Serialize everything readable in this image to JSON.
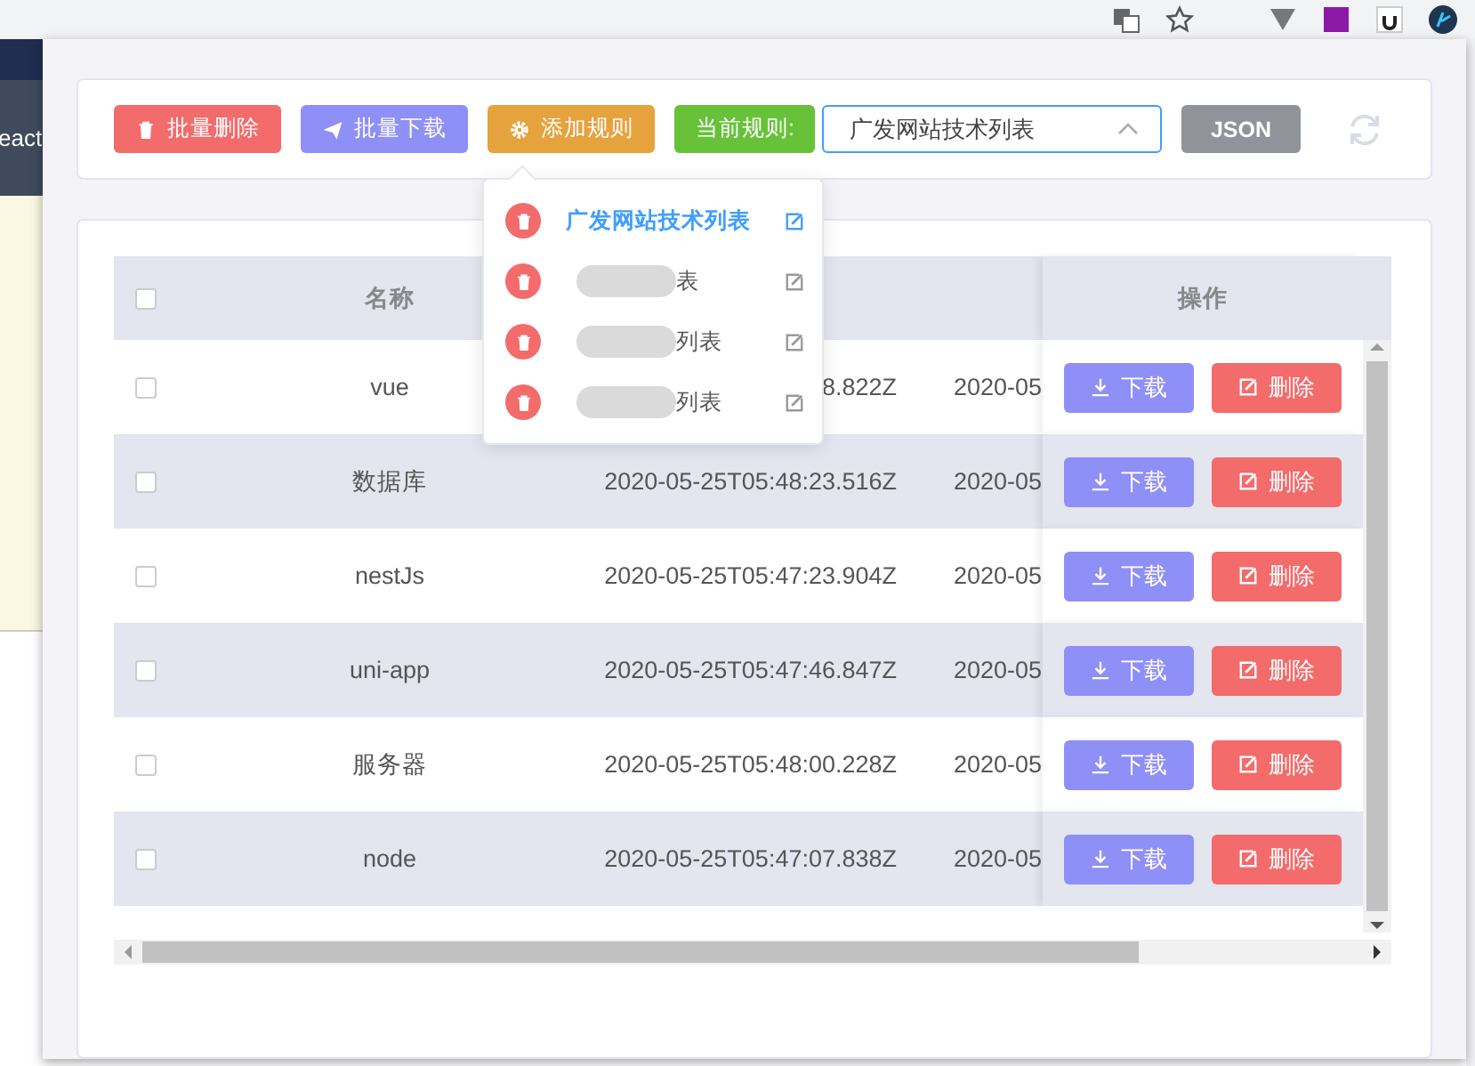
{
  "background_page": {
    "fragment": "eact"
  },
  "toolbar": {
    "buttons": [
      {
        "kind": "delete",
        "label": "批量删除"
      },
      {
        "kind": "download",
        "label": "批量下载"
      },
      {
        "kind": "add",
        "label": "添加规则"
      }
    ],
    "current_rule_label": "当前规则:",
    "rule_select": {
      "value": "广发网站技术列表",
      "expanded": true
    },
    "json_button": "JSON"
  },
  "rule_menu": {
    "items": [
      {
        "label": "广发网站技术列表",
        "redacted": false,
        "selected": true
      },
      {
        "label": "表",
        "redacted": true,
        "selected": false
      },
      {
        "label": "列表",
        "redacted": true,
        "selected": false
      },
      {
        "label": "列表",
        "redacted": true,
        "selected": false
      }
    ]
  },
  "table": {
    "header": {
      "select_all_checked": false,
      "name": "名称",
      "actions": "操作"
    },
    "rows": [
      {
        "checked": false,
        "name": "vue",
        "column_3": "8.822Z",
        "column_4": "2020-05",
        "download": "下载",
        "delete": "删除"
      },
      {
        "checked": false,
        "name": "数据库",
        "column_3": "2020-05-25T05:48:23.516Z",
        "column_4": "2020-05",
        "download": "下载",
        "delete": "删除"
      },
      {
        "checked": false,
        "name": "nestJs",
        "column_3": "2020-05-25T05:47:23.904Z",
        "column_4": "2020-05",
        "download": "下载",
        "delete": "删除"
      },
      {
        "checked": false,
        "name": "uni-app",
        "column_3": "2020-05-25T05:47:46.847Z",
        "column_4": "2020-05",
        "download": "下载",
        "delete": "删除"
      },
      {
        "checked": false,
        "name": "服务器",
        "column_3": "2020-05-25T05:48:00.228Z",
        "column_4": "2020-05",
        "download": "下载",
        "delete": "删除"
      },
      {
        "checked": false,
        "name": "node",
        "column_3": "2020-05-25T05:47:07.838Z",
        "column_4": "2020-05",
        "download": "下载",
        "delete": "删除"
      }
    ]
  }
}
